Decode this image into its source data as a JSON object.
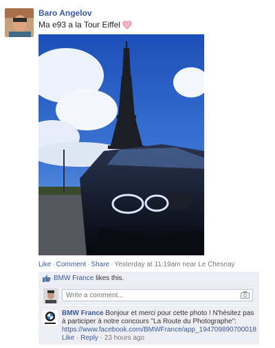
{
  "post": {
    "author": "Baro Angelov",
    "message": "Ma e93 a la Tour Eiffel",
    "message_emoji": "heart-icon"
  },
  "actions": {
    "like": "Like",
    "comment": "Comment",
    "share": "Share",
    "timestamp": "Yesterday at 11:19am near Le Chesnay"
  },
  "likes": {
    "name": "BMW France",
    "suffix": " likes this."
  },
  "compose": {
    "placeholder": "Write a comment..."
  },
  "comment": {
    "author": "BMW France",
    "text": "Bonjour et merci pour cette photo ! N'hésitez pas à participer à notre concours \"La Route du Photographe\":",
    "link": "https://www.facebook.com/BMWFrance/app_194709890700018",
    "like": "Like",
    "reply": "Reply",
    "time": "23 hours ago"
  },
  "colors": {
    "link": "#3b5998",
    "panel": "#edeff4",
    "heart": "#e8828f"
  }
}
